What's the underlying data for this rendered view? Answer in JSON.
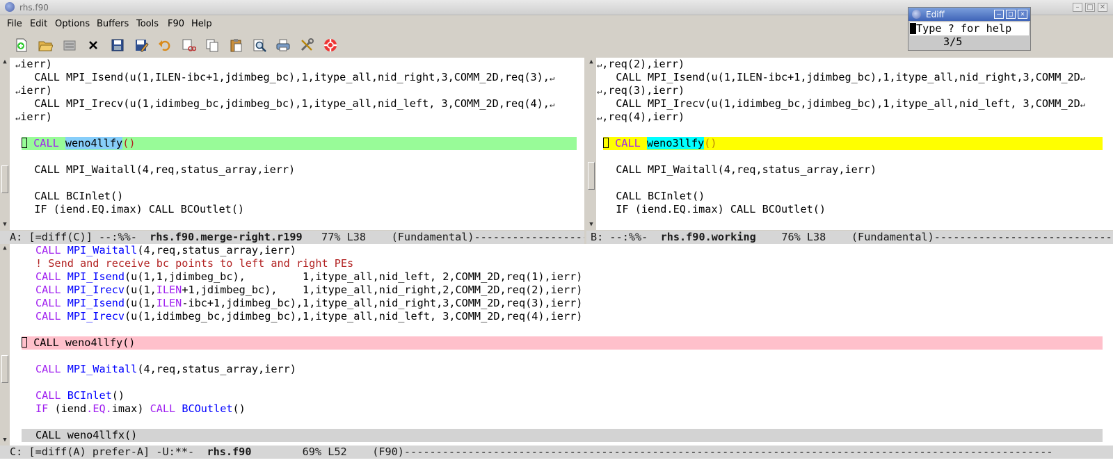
{
  "window": {
    "title": "rhs.f90"
  },
  "menubar": [
    "File",
    "Edit",
    "Options",
    "Buffers",
    "Tools",
    "F90",
    "Help"
  ],
  "toolbar": [
    "new-file-icon",
    "open-folder-icon",
    "dired-icon",
    "close-icon",
    "save-icon",
    "save-as-icon",
    "undo-icon",
    "cut-icon",
    "copy-icon",
    "paste-icon",
    "search-icon",
    "print-icon",
    "preferences-icon",
    "help-icon"
  ],
  "colors": {
    "diff_a_current": "#98fb98",
    "diff_b_current": "#ffff00",
    "diff_c_current": "#ffc0cb",
    "diff_other": "#d3d3d3",
    "fine_a": "#87cefa",
    "fine_b": "#00ffff"
  },
  "pane_a": {
    "lines": [
      "ierr)",
      "  CALL MPI_Isend(u(1,ILEN-ibc+1,jdimbeg_bc),1,itype_all,nid_right,3,COMM_2D,req(3),",
      "ierr)",
      "  CALL MPI_Irecv(u(1,idimbeg_bc,jdimbeg_bc),1,itype_all,nid_left, 3,COMM_2D,req(4),",
      "ierr)",
      "",
      "weno4llfy",
      "",
      "  CALL MPI_Waitall(4,req,status_array,ierr)",
      "",
      "  CALL BCInlet()",
      "  IF (iend.EQ.imax) CALL BCOutlet()"
    ],
    "diff_keyword": "CALL",
    "diff_parens": "()",
    "modeline_pre": "A: [=diff(C)] --:%%-  ",
    "modeline_buffer": "rhs.f90.merge-right.r199",
    "modeline_post": "   77% L38    (Fundamental)---------------------------------------------------------------"
  },
  "pane_b": {
    "lines": [
      ",req(2),ierr)",
      "  CALL MPI_Isend(u(1,ILEN-ibc+1,jdimbeg_bc),1,itype_all,nid_right,3,COMM_2D",
      ",req(3),ierr)",
      "  CALL MPI_Irecv(u(1,idimbeg_bc,jdimbeg_bc),1,itype_all,nid_left, 3,COMM_2D",
      ",req(4),ierr)",
      "",
      "weno3llfy",
      "",
      "  CALL MPI_Waitall(4,req,status_array,ierr)",
      "",
      "  CALL BCInlet()",
      "  IF (iend.EQ.imax) CALL BCOutlet()"
    ],
    "modeline_pre": "B: --:%%-  ",
    "modeline_buffer": "rhs.f90.working",
    "modeline_post": "    76% L38    (Fundamental)-------------------------------------------------------"
  },
  "pane_c": {
    "l1": {
      "a": "CALL",
      "b": "MPI_Waitall",
      "c": "(4,req,status_array,ierr)"
    },
    "l2": "! Send and receive bc points to left and right PEs",
    "l3": {
      "a": "CALL",
      "b": "MPI_Isend",
      "c": "(u(1,1,jdimbeg_bc),         1,itype_all,nid_left, 2,COMM_2D,req(1),ierr)"
    },
    "l4": {
      "a": "CALL",
      "b": "MPI_Irecv",
      "c": "(u(1,",
      "d": "ILEN",
      "e": "+1,jdimbeg_bc),    1,itype_all,nid_right,2,COMM_2D,req(2),ierr)"
    },
    "l5": {
      "a": "CALL",
      "b": "MPI_Isend",
      "c": "(u(1,",
      "d": "ILEN",
      "e": "-ibc+1,jdimbeg_bc),1,itype_all,nid_right,3,COMM_2D,req(3),ierr)"
    },
    "l6": {
      "a": "CALL",
      "b": "MPI_Irecv",
      "c": "(u(1,idimbeg_bc,jdimbeg_bc),1,itype_all,nid_left, 3,COMM_2D,req(4),ierr)"
    },
    "l8": "CALL weno4llfy()",
    "l10": {
      "a": "CALL",
      "b": "MPI_Waitall",
      "c": "(4,req,status_array,ierr)"
    },
    "l12": {
      "a": "CALL",
      "b": "BCInlet",
      "c": "()"
    },
    "l13": {
      "a": "IF",
      "b": " (iend",
      "c": ".EQ.",
      "d": "imax) ",
      "e": "CALL",
      "f": "BCOutlet",
      "g": "()"
    },
    "l15": "CALL weno4llfx()",
    "modeline_pre": "C: [=diff(A) prefer-A] -U:**-  ",
    "modeline_buffer": "rhs.f90",
    "modeline_post": "        69% L52    (F90)------------------------------------------------------------------------------------------------------"
  },
  "ediff": {
    "title": "Ediff",
    "help": "Type ? for help",
    "counter": "3/5"
  }
}
